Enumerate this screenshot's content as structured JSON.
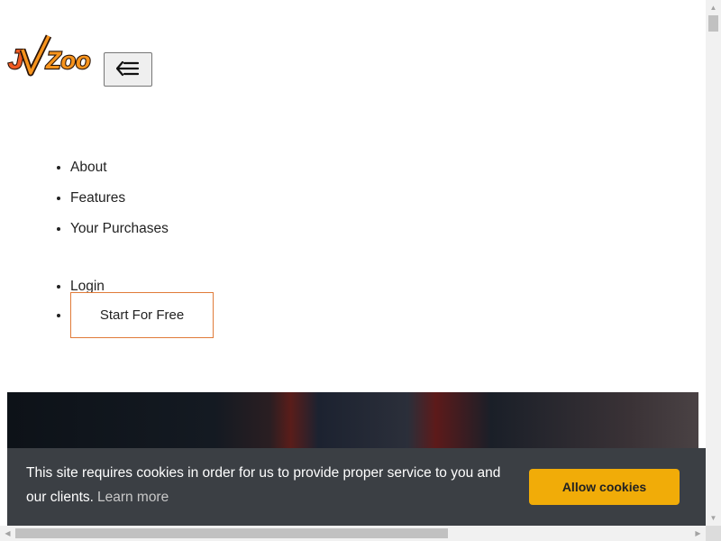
{
  "header": {
    "logo_text": "JVZoo",
    "menu_toggle_icon": "menu-collapse-icon"
  },
  "nav": {
    "items": [
      {
        "label": "About"
      },
      {
        "label": "Features"
      },
      {
        "label": "Your Purchases"
      }
    ],
    "login_label": "Login",
    "start_label": "Start For Free"
  },
  "cookie_banner": {
    "message": "This site requires cookies in order for us to provide proper service to you and our clients.",
    "learn_more": "Learn more",
    "allow_label": "Allow cookies"
  },
  "colors": {
    "brand_orange": "#e0692a",
    "cookie_button": "#f1ac08",
    "cookie_bg": "#3b3f44"
  }
}
